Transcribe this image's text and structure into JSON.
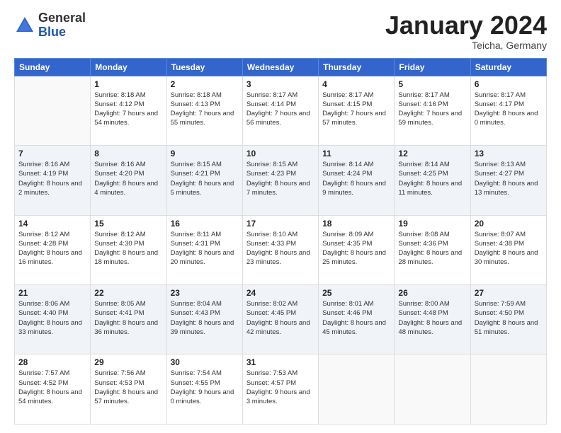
{
  "header": {
    "logo_general": "General",
    "logo_blue": "Blue",
    "month_title": "January 2024",
    "location": "Teicha, Germany"
  },
  "weekdays": [
    "Sunday",
    "Monday",
    "Tuesday",
    "Wednesday",
    "Thursday",
    "Friday",
    "Saturday"
  ],
  "weeks": [
    [
      {
        "day": "",
        "sunrise": "",
        "sunset": "",
        "daylight": ""
      },
      {
        "day": "1",
        "sunrise": "Sunrise: 8:18 AM",
        "sunset": "Sunset: 4:12 PM",
        "daylight": "Daylight: 7 hours and 54 minutes."
      },
      {
        "day": "2",
        "sunrise": "Sunrise: 8:18 AM",
        "sunset": "Sunset: 4:13 PM",
        "daylight": "Daylight: 7 hours and 55 minutes."
      },
      {
        "day": "3",
        "sunrise": "Sunrise: 8:17 AM",
        "sunset": "Sunset: 4:14 PM",
        "daylight": "Daylight: 7 hours and 56 minutes."
      },
      {
        "day": "4",
        "sunrise": "Sunrise: 8:17 AM",
        "sunset": "Sunset: 4:15 PM",
        "daylight": "Daylight: 7 hours and 57 minutes."
      },
      {
        "day": "5",
        "sunrise": "Sunrise: 8:17 AM",
        "sunset": "Sunset: 4:16 PM",
        "daylight": "Daylight: 7 hours and 59 minutes."
      },
      {
        "day": "6",
        "sunrise": "Sunrise: 8:17 AM",
        "sunset": "Sunset: 4:17 PM",
        "daylight": "Daylight: 8 hours and 0 minutes."
      }
    ],
    [
      {
        "day": "7",
        "sunrise": "Sunrise: 8:16 AM",
        "sunset": "Sunset: 4:19 PM",
        "daylight": "Daylight: 8 hours and 2 minutes."
      },
      {
        "day": "8",
        "sunrise": "Sunrise: 8:16 AM",
        "sunset": "Sunset: 4:20 PM",
        "daylight": "Daylight: 8 hours and 4 minutes."
      },
      {
        "day": "9",
        "sunrise": "Sunrise: 8:15 AM",
        "sunset": "Sunset: 4:21 PM",
        "daylight": "Daylight: 8 hours and 5 minutes."
      },
      {
        "day": "10",
        "sunrise": "Sunrise: 8:15 AM",
        "sunset": "Sunset: 4:23 PM",
        "daylight": "Daylight: 8 hours and 7 minutes."
      },
      {
        "day": "11",
        "sunrise": "Sunrise: 8:14 AM",
        "sunset": "Sunset: 4:24 PM",
        "daylight": "Daylight: 8 hours and 9 minutes."
      },
      {
        "day": "12",
        "sunrise": "Sunrise: 8:14 AM",
        "sunset": "Sunset: 4:25 PM",
        "daylight": "Daylight: 8 hours and 11 minutes."
      },
      {
        "day": "13",
        "sunrise": "Sunrise: 8:13 AM",
        "sunset": "Sunset: 4:27 PM",
        "daylight": "Daylight: 8 hours and 13 minutes."
      }
    ],
    [
      {
        "day": "14",
        "sunrise": "Sunrise: 8:12 AM",
        "sunset": "Sunset: 4:28 PM",
        "daylight": "Daylight: 8 hours and 16 minutes."
      },
      {
        "day": "15",
        "sunrise": "Sunrise: 8:12 AM",
        "sunset": "Sunset: 4:30 PM",
        "daylight": "Daylight: 8 hours and 18 minutes."
      },
      {
        "day": "16",
        "sunrise": "Sunrise: 8:11 AM",
        "sunset": "Sunset: 4:31 PM",
        "daylight": "Daylight: 8 hours and 20 minutes."
      },
      {
        "day": "17",
        "sunrise": "Sunrise: 8:10 AM",
        "sunset": "Sunset: 4:33 PM",
        "daylight": "Daylight: 8 hours and 23 minutes."
      },
      {
        "day": "18",
        "sunrise": "Sunrise: 8:09 AM",
        "sunset": "Sunset: 4:35 PM",
        "daylight": "Daylight: 8 hours and 25 minutes."
      },
      {
        "day": "19",
        "sunrise": "Sunrise: 8:08 AM",
        "sunset": "Sunset: 4:36 PM",
        "daylight": "Daylight: 8 hours and 28 minutes."
      },
      {
        "day": "20",
        "sunrise": "Sunrise: 8:07 AM",
        "sunset": "Sunset: 4:38 PM",
        "daylight": "Daylight: 8 hours and 30 minutes."
      }
    ],
    [
      {
        "day": "21",
        "sunrise": "Sunrise: 8:06 AM",
        "sunset": "Sunset: 4:40 PM",
        "daylight": "Daylight: 8 hours and 33 minutes."
      },
      {
        "day": "22",
        "sunrise": "Sunrise: 8:05 AM",
        "sunset": "Sunset: 4:41 PM",
        "daylight": "Daylight: 8 hours and 36 minutes."
      },
      {
        "day": "23",
        "sunrise": "Sunrise: 8:04 AM",
        "sunset": "Sunset: 4:43 PM",
        "daylight": "Daylight: 8 hours and 39 minutes."
      },
      {
        "day": "24",
        "sunrise": "Sunrise: 8:02 AM",
        "sunset": "Sunset: 4:45 PM",
        "daylight": "Daylight: 8 hours and 42 minutes."
      },
      {
        "day": "25",
        "sunrise": "Sunrise: 8:01 AM",
        "sunset": "Sunset: 4:46 PM",
        "daylight": "Daylight: 8 hours and 45 minutes."
      },
      {
        "day": "26",
        "sunrise": "Sunrise: 8:00 AM",
        "sunset": "Sunset: 4:48 PM",
        "daylight": "Daylight: 8 hours and 48 minutes."
      },
      {
        "day": "27",
        "sunrise": "Sunrise: 7:59 AM",
        "sunset": "Sunset: 4:50 PM",
        "daylight": "Daylight: 8 hours and 51 minutes."
      }
    ],
    [
      {
        "day": "28",
        "sunrise": "Sunrise: 7:57 AM",
        "sunset": "Sunset: 4:52 PM",
        "daylight": "Daylight: 8 hours and 54 minutes."
      },
      {
        "day": "29",
        "sunrise": "Sunrise: 7:56 AM",
        "sunset": "Sunset: 4:53 PM",
        "daylight": "Daylight: 8 hours and 57 minutes."
      },
      {
        "day": "30",
        "sunrise": "Sunrise: 7:54 AM",
        "sunset": "Sunset: 4:55 PM",
        "daylight": "Daylight: 9 hours and 0 minutes."
      },
      {
        "day": "31",
        "sunrise": "Sunrise: 7:53 AM",
        "sunset": "Sunset: 4:57 PM",
        "daylight": "Daylight: 9 hours and 3 minutes."
      },
      {
        "day": "",
        "sunrise": "",
        "sunset": "",
        "daylight": ""
      },
      {
        "day": "",
        "sunrise": "",
        "sunset": "",
        "daylight": ""
      },
      {
        "day": "",
        "sunrise": "",
        "sunset": "",
        "daylight": ""
      }
    ]
  ]
}
